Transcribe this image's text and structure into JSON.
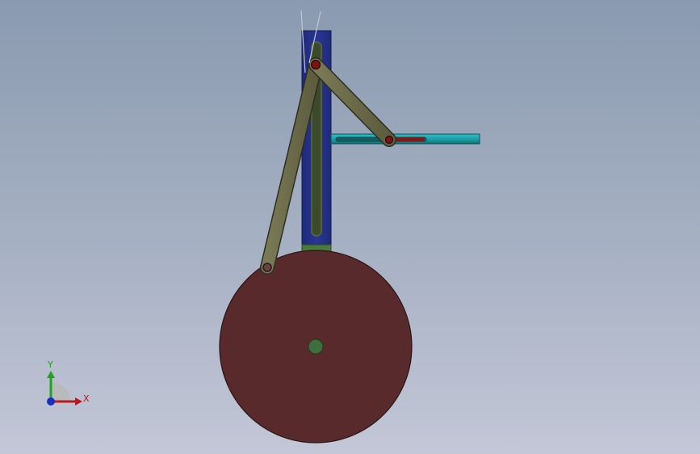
{
  "viewport": {
    "background_top": "#8a9ab0",
    "background_bottom": "#c3c7d6"
  },
  "model": {
    "components": [
      {
        "name": "vertical-frame",
        "color": "#26318a"
      },
      {
        "name": "vertical-slot",
        "color": "#4a5a2c"
      },
      {
        "name": "horizontal-rail",
        "color": "#1fa1a8"
      },
      {
        "name": "rail-slot-slider",
        "color": "#7a1a1a"
      },
      {
        "name": "crank-disk",
        "color": "#5a2a2c"
      },
      {
        "name": "disk-center-pin",
        "color": "#3f6e3c"
      },
      {
        "name": "long-link",
        "color": "#6b6b4a"
      },
      {
        "name": "short-link",
        "color": "#6b6b4a"
      },
      {
        "name": "link-pin",
        "color": "#7a1414"
      },
      {
        "name": "sketch-lines",
        "color": "#b8b8b8"
      }
    ]
  },
  "triad": {
    "x_label": "X",
    "y_label": "Y",
    "x_color": "#c01818",
    "y_color": "#22a022",
    "z_color": "#1a2fc0"
  }
}
